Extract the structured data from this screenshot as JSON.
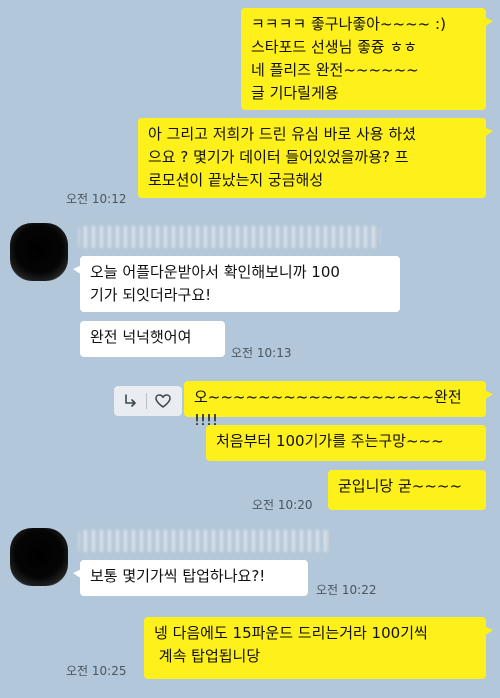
{
  "messages": [
    {
      "id": "m1",
      "side": "me",
      "text": "ㅋㅋㅋㅋ 좋구나좋아~~~~ :)\n스타포드 선생님 좋즁 ㅎㅎ\n네 플리즈 완전~~~~~~\n글 기다릴게용"
    },
    {
      "id": "m2",
      "side": "me",
      "text": "아 그리고 저희가 드린 유심 바로 사용 하셨\n으요 ? 몇기가 데이터 들어있었을까용? 프\n로모션이 끝났는지 궁금해성",
      "time": "오전 10:12"
    },
    {
      "id": "m3",
      "side": "them",
      "text": "오늘 어플다운받아서 확인해보니까 100\n기가 되잇더라구요!"
    },
    {
      "id": "m4",
      "side": "them",
      "text": "완전 넉넉햇어여",
      "time": "오전 10:13"
    },
    {
      "id": "m5",
      "side": "me",
      "text": "오~~~~~~~~~~~~~~~~~~완전 !!!!"
    },
    {
      "id": "m6",
      "side": "me",
      "text": "처음부터 100기가를 주는구망~~~"
    },
    {
      "id": "m7",
      "side": "me",
      "text": "굳입니당 굳~~~~",
      "time": "오전 10:20"
    },
    {
      "id": "m8",
      "side": "them",
      "text": "보통 몇기가씩 탑업하나요?!",
      "time": "오전 10:22"
    },
    {
      "id": "m9",
      "side": "me",
      "text": "넹 다음에도 15파운드 드리는거라 100기씩\n 계속 탑업됩니당",
      "time": "오전 10:25"
    }
  ],
  "icons": {
    "reply": "reply-arrow-icon",
    "like": "heart-icon"
  },
  "colors": {
    "background": "#b2c7d9",
    "my_bubble": "#fef01b",
    "their_bubble": "#ffffff"
  }
}
